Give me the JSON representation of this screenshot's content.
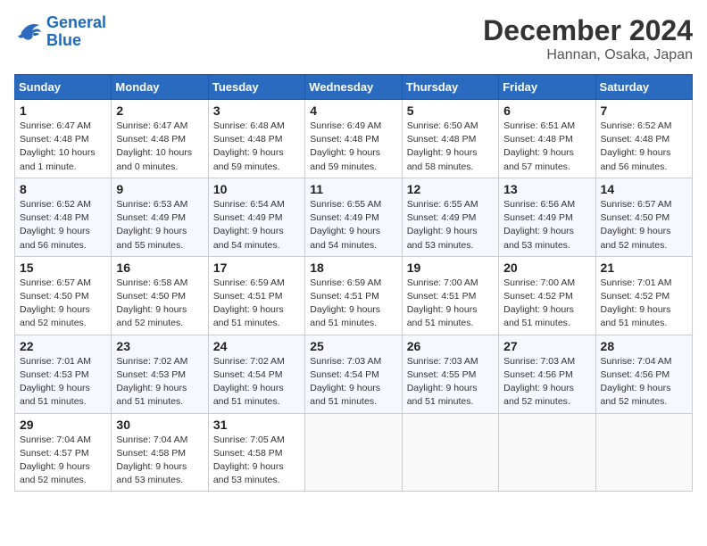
{
  "logo": {
    "line1": "General",
    "line2": "Blue"
  },
  "title": "December 2024",
  "subtitle": "Hannan, Osaka, Japan",
  "weekdays": [
    "Sunday",
    "Monday",
    "Tuesday",
    "Wednesday",
    "Thursday",
    "Friday",
    "Saturday"
  ],
  "weeks": [
    [
      {
        "day": "1",
        "info": "Sunrise: 6:47 AM\nSunset: 4:48 PM\nDaylight: 10 hours\nand 1 minute."
      },
      {
        "day": "2",
        "info": "Sunrise: 6:47 AM\nSunset: 4:48 PM\nDaylight: 10 hours\nand 0 minutes."
      },
      {
        "day": "3",
        "info": "Sunrise: 6:48 AM\nSunset: 4:48 PM\nDaylight: 9 hours\nand 59 minutes."
      },
      {
        "day": "4",
        "info": "Sunrise: 6:49 AM\nSunset: 4:48 PM\nDaylight: 9 hours\nand 59 minutes."
      },
      {
        "day": "5",
        "info": "Sunrise: 6:50 AM\nSunset: 4:48 PM\nDaylight: 9 hours\nand 58 minutes."
      },
      {
        "day": "6",
        "info": "Sunrise: 6:51 AM\nSunset: 4:48 PM\nDaylight: 9 hours\nand 57 minutes."
      },
      {
        "day": "7",
        "info": "Sunrise: 6:52 AM\nSunset: 4:48 PM\nDaylight: 9 hours\nand 56 minutes."
      }
    ],
    [
      {
        "day": "8",
        "info": "Sunrise: 6:52 AM\nSunset: 4:48 PM\nDaylight: 9 hours\nand 56 minutes."
      },
      {
        "day": "9",
        "info": "Sunrise: 6:53 AM\nSunset: 4:49 PM\nDaylight: 9 hours\nand 55 minutes."
      },
      {
        "day": "10",
        "info": "Sunrise: 6:54 AM\nSunset: 4:49 PM\nDaylight: 9 hours\nand 54 minutes."
      },
      {
        "day": "11",
        "info": "Sunrise: 6:55 AM\nSunset: 4:49 PM\nDaylight: 9 hours\nand 54 minutes."
      },
      {
        "day": "12",
        "info": "Sunrise: 6:55 AM\nSunset: 4:49 PM\nDaylight: 9 hours\nand 53 minutes."
      },
      {
        "day": "13",
        "info": "Sunrise: 6:56 AM\nSunset: 4:49 PM\nDaylight: 9 hours\nand 53 minutes."
      },
      {
        "day": "14",
        "info": "Sunrise: 6:57 AM\nSunset: 4:50 PM\nDaylight: 9 hours\nand 52 minutes."
      }
    ],
    [
      {
        "day": "15",
        "info": "Sunrise: 6:57 AM\nSunset: 4:50 PM\nDaylight: 9 hours\nand 52 minutes."
      },
      {
        "day": "16",
        "info": "Sunrise: 6:58 AM\nSunset: 4:50 PM\nDaylight: 9 hours\nand 52 minutes."
      },
      {
        "day": "17",
        "info": "Sunrise: 6:59 AM\nSunset: 4:51 PM\nDaylight: 9 hours\nand 51 minutes."
      },
      {
        "day": "18",
        "info": "Sunrise: 6:59 AM\nSunset: 4:51 PM\nDaylight: 9 hours\nand 51 minutes."
      },
      {
        "day": "19",
        "info": "Sunrise: 7:00 AM\nSunset: 4:51 PM\nDaylight: 9 hours\nand 51 minutes."
      },
      {
        "day": "20",
        "info": "Sunrise: 7:00 AM\nSunset: 4:52 PM\nDaylight: 9 hours\nand 51 minutes."
      },
      {
        "day": "21",
        "info": "Sunrise: 7:01 AM\nSunset: 4:52 PM\nDaylight: 9 hours\nand 51 minutes."
      }
    ],
    [
      {
        "day": "22",
        "info": "Sunrise: 7:01 AM\nSunset: 4:53 PM\nDaylight: 9 hours\nand 51 minutes."
      },
      {
        "day": "23",
        "info": "Sunrise: 7:02 AM\nSunset: 4:53 PM\nDaylight: 9 hours\nand 51 minutes."
      },
      {
        "day": "24",
        "info": "Sunrise: 7:02 AM\nSunset: 4:54 PM\nDaylight: 9 hours\nand 51 minutes."
      },
      {
        "day": "25",
        "info": "Sunrise: 7:03 AM\nSunset: 4:54 PM\nDaylight: 9 hours\nand 51 minutes."
      },
      {
        "day": "26",
        "info": "Sunrise: 7:03 AM\nSunset: 4:55 PM\nDaylight: 9 hours\nand 51 minutes."
      },
      {
        "day": "27",
        "info": "Sunrise: 7:03 AM\nSunset: 4:56 PM\nDaylight: 9 hours\nand 52 minutes."
      },
      {
        "day": "28",
        "info": "Sunrise: 7:04 AM\nSunset: 4:56 PM\nDaylight: 9 hours\nand 52 minutes."
      }
    ],
    [
      {
        "day": "29",
        "info": "Sunrise: 7:04 AM\nSunset: 4:57 PM\nDaylight: 9 hours\nand 52 minutes."
      },
      {
        "day": "30",
        "info": "Sunrise: 7:04 AM\nSunset: 4:58 PM\nDaylight: 9 hours\nand 53 minutes."
      },
      {
        "day": "31",
        "info": "Sunrise: 7:05 AM\nSunset: 4:58 PM\nDaylight: 9 hours\nand 53 minutes."
      },
      {
        "day": "",
        "info": ""
      },
      {
        "day": "",
        "info": ""
      },
      {
        "day": "",
        "info": ""
      },
      {
        "day": "",
        "info": ""
      }
    ]
  ]
}
